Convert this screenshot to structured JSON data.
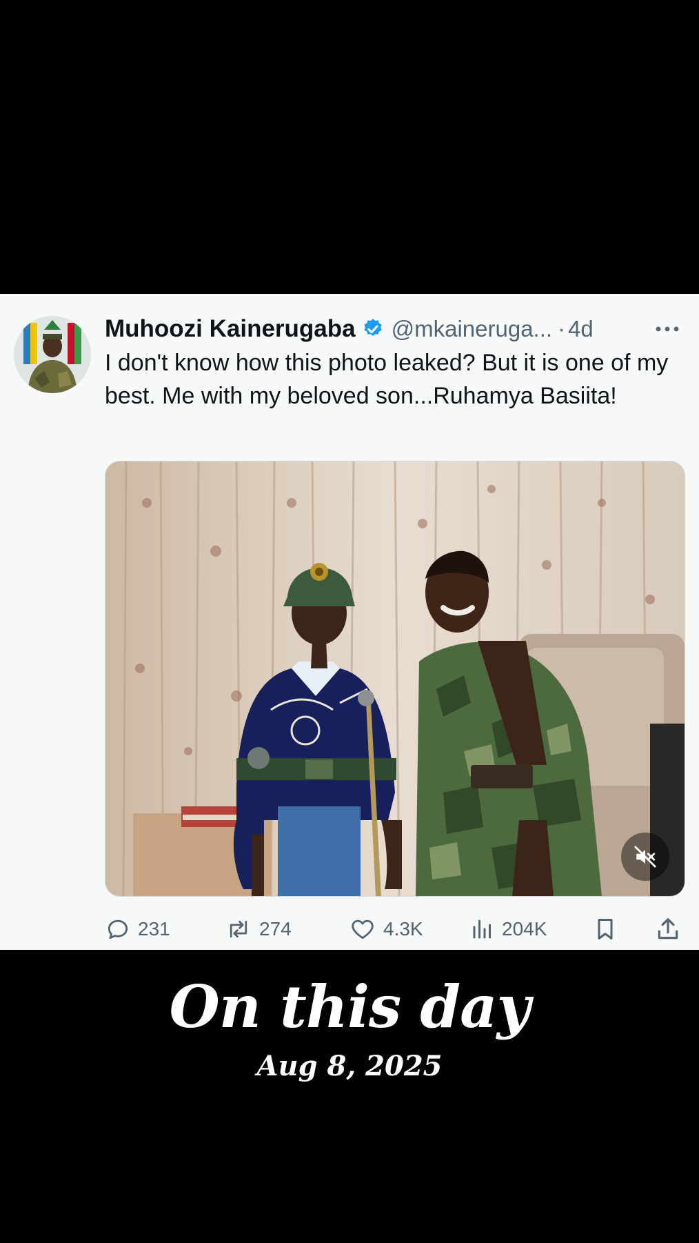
{
  "tweet": {
    "author_name": "Muhoozi Kainerugaba",
    "handle": "@mkaineruga...",
    "separator": "·",
    "time": "4d",
    "text": "I don't know how this photo leaked? But it is one of my best. Me with my beloved son...Ruhamya Basiita!",
    "more_icon": "more-horizontal-icon",
    "verified_icon": "verified-badge-icon",
    "verified_color": "#1d9bf0",
    "media": {
      "type": "video",
      "mute_icon": "muted-speaker-icon"
    },
    "actions": {
      "replies": "231",
      "reposts": "274",
      "likes": "4.3K",
      "views": "204K",
      "bookmark_icon": "bookmark-icon",
      "share_icon": "share-icon"
    }
  },
  "banner": {
    "title": "On this day",
    "date": "Aug 8, 2025"
  },
  "colors": {
    "background": "#000000",
    "card": "#f7f9f9",
    "text_primary": "#0f1419",
    "text_secondary": "#536471",
    "accent": "#1d9bf0"
  }
}
